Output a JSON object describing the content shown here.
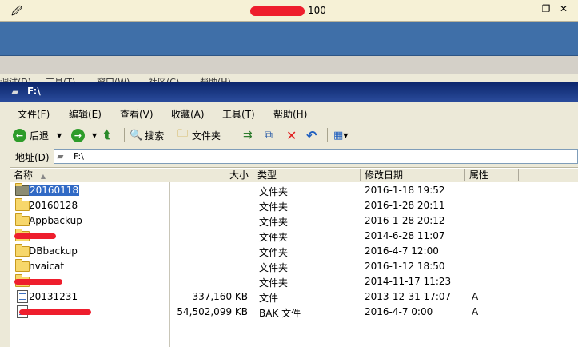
{
  "outer_window": {
    "title": "100",
    "controls": [
      "_",
      "❐",
      "✕"
    ]
  },
  "cutoff_menu": [
    "调试(D)",
    "工具(T)",
    "窗口(W)",
    "社区(C)",
    "帮助(H)"
  ],
  "explorer": {
    "title": "F:\\",
    "menu": [
      "文件(F)",
      "编辑(E)",
      "查看(V)",
      "收藏(A)",
      "工具(T)",
      "帮助(H)"
    ],
    "toolbar": {
      "back_label": "后退",
      "search_label": "搜索",
      "folders_label": "文件夹"
    },
    "address": {
      "label": "地址(D)",
      "value": "F:\\"
    },
    "columns": {
      "name": "名称",
      "size": "大小",
      "type": "类型",
      "modified": "修改日期",
      "attributes": "属性"
    },
    "files": [
      {
        "name": "20160118",
        "size": "",
        "type": "文件夹",
        "modified": "2016-1-18 19:52",
        "attr": "",
        "kind": "folder",
        "selected": true
      },
      {
        "name": "20160128",
        "size": "",
        "type": "文件夹",
        "modified": "2016-1-28 20:11",
        "attr": "",
        "kind": "folder"
      },
      {
        "name": "Appbackup",
        "size": "",
        "type": "文件夹",
        "modified": "2016-1-28 20:12",
        "attr": "",
        "kind": "folder"
      },
      {
        "name": "",
        "size": "",
        "type": "文件夹",
        "modified": "2014-6-28 11:07",
        "attr": "",
        "kind": "folder",
        "redacted": true
      },
      {
        "name": "DBbackup",
        "size": "",
        "type": "文件夹",
        "modified": "2016-4-7 12:00",
        "attr": "",
        "kind": "folder"
      },
      {
        "name": "nvaicat",
        "size": "",
        "type": "文件夹",
        "modified": "2016-1-12 18:50",
        "attr": "",
        "kind": "folder"
      },
      {
        "name": "",
        "size": "",
        "type": "文件夹",
        "modified": "2014-11-17 11:23",
        "attr": "",
        "kind": "folder",
        "redacted": true
      },
      {
        "name": "20131231",
        "size": "337,160 KB",
        "type": "文件",
        "modified": "2013-12-31 17:07",
        "attr": "A",
        "kind": "file"
      },
      {
        "name": "",
        "size": "54,502,099 KB",
        "type": "BAK 文件",
        "modified": "2016-4-7 0:00",
        "attr": "A",
        "kind": "file",
        "redacted": true
      }
    ]
  },
  "colors": {
    "outer_title_bg": "#f6f1d6",
    "outer_blue": "#3f6fa8",
    "explorer_title": "#0a246a",
    "chrome": "#ece9d8",
    "redaction": "#ee1e2d",
    "selection": "#316ac5"
  }
}
